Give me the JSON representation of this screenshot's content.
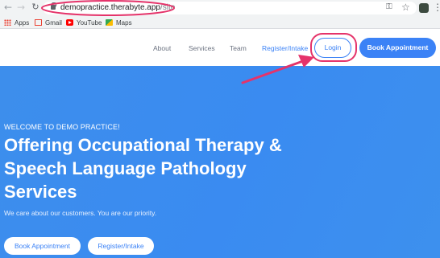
{
  "browser": {
    "url_host": "demopractice.therabyte.app",
    "url_path": "/site",
    "bookmarks": [
      {
        "label": "Apps",
        "icon": "apps-grid-icon"
      },
      {
        "label": "Gmail",
        "icon": "gmail-icon"
      },
      {
        "label": "YouTube",
        "icon": "youtube-icon"
      },
      {
        "label": "Maps",
        "icon": "maps-icon"
      }
    ]
  },
  "header": {
    "nav": {
      "about": "About",
      "services": "Services",
      "team": "Team",
      "register": "Register/Intake"
    },
    "login_label": "Login",
    "book_label": "Book Appointment"
  },
  "hero": {
    "kicker": "WELCOME TO DEMO PRACTICE!",
    "title_lines": [
      "Offering Occupational Therapy &",
      "Speech Language Pathology",
      "Services"
    ],
    "subtitle": "We care about our customers. You are our priority.",
    "book_label": "Book Appointment",
    "register_label": "Register/Intake"
  },
  "colors": {
    "brand_blue": "#3b82f6",
    "hero_bg": "#3a8bf1",
    "annotation": "#e5336a"
  }
}
